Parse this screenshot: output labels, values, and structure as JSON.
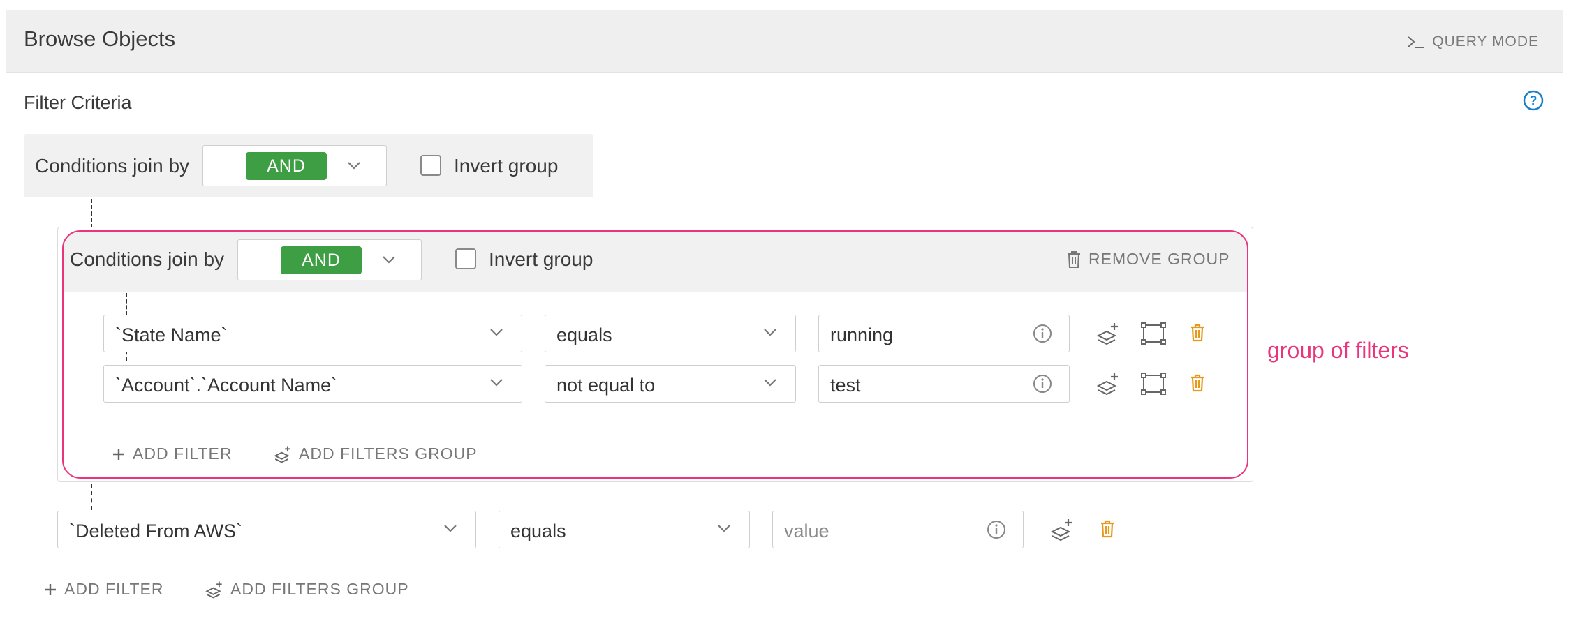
{
  "header": {
    "title": "Browse Objects",
    "query_mode_label": "QUERY MODE"
  },
  "filter_criteria": {
    "label": "Filter Criteria"
  },
  "outer_group": {
    "join_label": "Conditions join by",
    "join_value": "AND",
    "invert_label": "Invert group",
    "invert_checked": false
  },
  "inner_group": {
    "join_label": "Conditions join by",
    "join_value": "AND",
    "invert_label": "Invert group",
    "invert_checked": false,
    "remove_label": "REMOVE GROUP",
    "filters": [
      {
        "field": "`State Name`",
        "operator": "equals",
        "value": "running"
      },
      {
        "field": "`Account`.`Account Name`",
        "operator": "not equal to",
        "value": "test"
      }
    ],
    "add_filter_label": "ADD FILTER",
    "add_group_label": "ADD FILTERS GROUP"
  },
  "outer_filter": {
    "field": "`Deleted From AWS`",
    "operator": "equals",
    "value_placeholder": "value"
  },
  "outer_actions": {
    "add_filter_label": "ADD FILTER",
    "add_group_label": "ADD FILTERS GROUP"
  },
  "annotation": {
    "text": "group of filters"
  },
  "colors": {
    "and_badge": "#3e9e44",
    "annotation": "#e8357b",
    "help_icon": "#1a7fc9",
    "trash_icon": "#e69a1a"
  }
}
